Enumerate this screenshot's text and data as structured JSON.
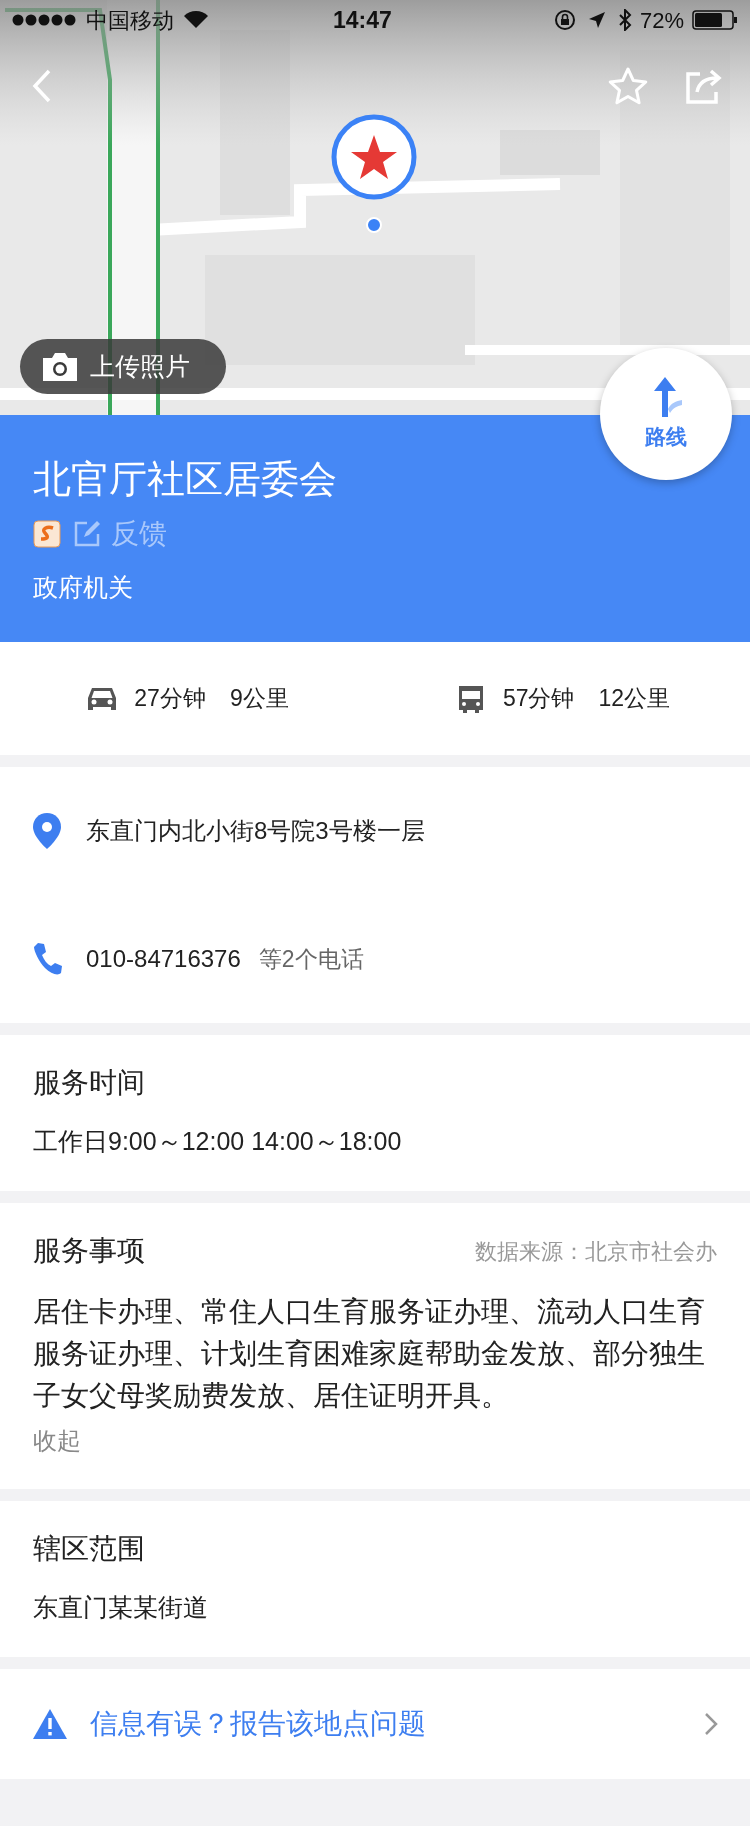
{
  "status_bar": {
    "carrier": "中国移动",
    "time": "14:47",
    "battery": "72%"
  },
  "map_actions": {
    "upload_photo": "上传照片",
    "route": "路线"
  },
  "place": {
    "name": "北官厅社区居委会",
    "feedback": "反馈",
    "category": "政府机关"
  },
  "travel": [
    {
      "kind": "car",
      "time": "27分钟",
      "distance": "9公里"
    },
    {
      "kind": "bus",
      "time": "57分钟",
      "distance": "12公里"
    }
  ],
  "contact": {
    "address": "东直门内北小街8号院3号楼一层",
    "phone": "010-84716376",
    "phone_more": "等2个电话"
  },
  "sections": [
    {
      "kind": "hours",
      "title": "服务时间",
      "body": "工作日9:00～12:00 14:00～18:00"
    },
    {
      "kind": "services",
      "title": "服务事项",
      "source": "数据来源：北京市社会办",
      "body": "居住卡办理、常住人口生育服务证办理、流动人口生育服务证办理、计划生育困难家庭帮助金发放、部分独生子女父母奖励费发放、居住证明开具。",
      "collapse": "收起"
    },
    {
      "kind": "area",
      "title": "辖区范围",
      "body": "东直门某某街道"
    }
  ],
  "report": "信息有误？报告该地点问题"
}
